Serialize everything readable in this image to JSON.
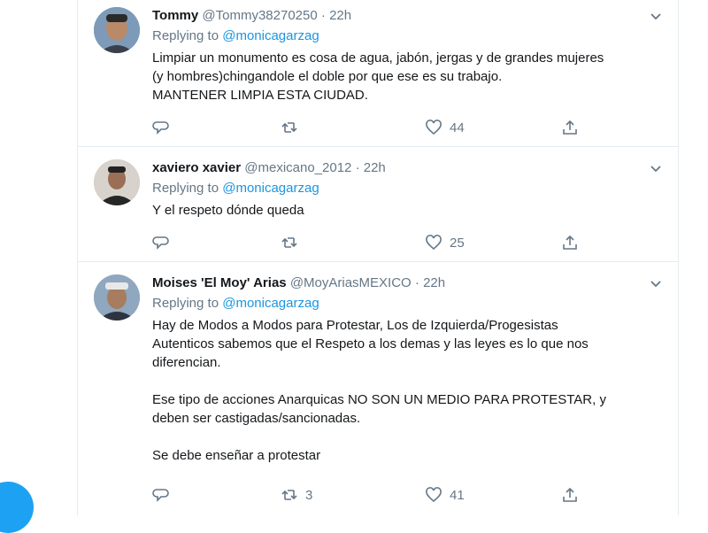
{
  "tweets": [
    {
      "name": "Tommy",
      "handle": "@Tommy38270250",
      "dot": "·",
      "time": "22h",
      "replying_prefix": "Replying to",
      "replying_to": "@monicagarzag",
      "text": "Limpiar un monumento es cosa de agua, jabón, jergas y de grandes mujeres\n(y hombres)chingandole el doble por que ese es su trabajo.\nMANTENER LIMPIA ESTA CIUDAD.",
      "retweets": "",
      "likes": "44"
    },
    {
      "name": "xaviero xavier",
      "handle": "@mexicano_2012",
      "dot": "·",
      "time": "22h",
      "replying_prefix": "Replying to",
      "replying_to": "@monicagarzag",
      "text": "Y el respeto dónde queda",
      "retweets": "",
      "likes": "25"
    },
    {
      "name": "Moises 'El Moy' Arias",
      "handle": "@MoyAriasMEXICO",
      "dot": "·",
      "time": "22h",
      "replying_prefix": "Replying to",
      "replying_to": "@monicagarzag",
      "text": "Hay de Modos a Modos para Protestar, Los de Izquierda/Progesistas\nAutenticos sabemos que el Respeto a los demas y las leyes es lo que nos\ndiferencian.\n\nEse tipo de acciones Anarquicas NO SON UN MEDIO PARA PROTESTAR, y\ndeben ser castigadas/sancionadas.\n\nSe debe enseñar a protestar",
      "retweets": "3",
      "likes": "41"
    }
  ],
  "colors": {
    "accent": "#1da1f2",
    "mention": "#1b95e0",
    "muted": "#657786",
    "border": "#e6ecf0"
  }
}
